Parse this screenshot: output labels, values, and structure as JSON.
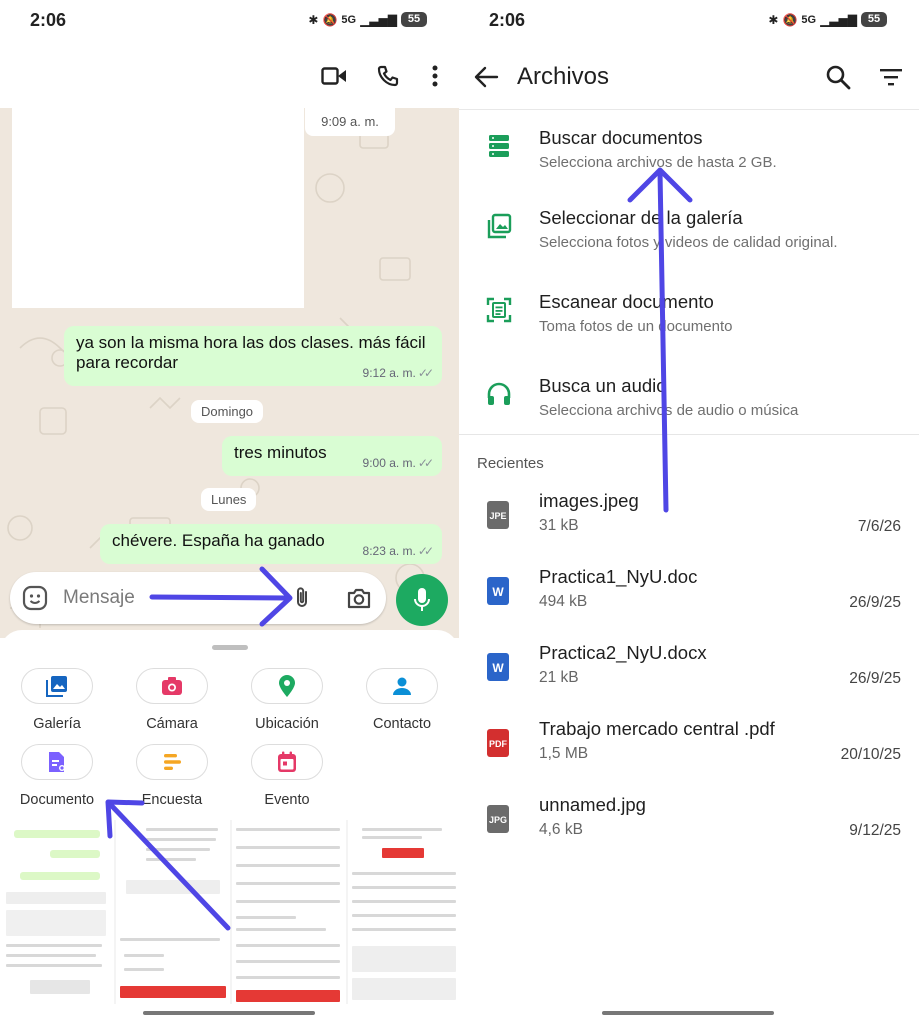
{
  "colors": {
    "whatsapp_green": "#1daa61",
    "bubble_out": "#d9fdd3",
    "chat_background": "#efe7dd",
    "annotation_arrow": "#4f46e5",
    "files_icon_green": "#1b9e5a"
  },
  "left_panel": {
    "status_bar": {
      "time": "2:06",
      "network": "5G",
      "battery": "55"
    },
    "header_icons": [
      "video-call-icon",
      "voice-call-icon",
      "more-options-icon"
    ],
    "image_time": "9:09 a. m.",
    "messages": [
      {
        "text": "ya son la misma hora las dos clases. más fácil para recordar",
        "time": "9:12 a. m.",
        "status": "read"
      },
      {
        "text": "tres minutos",
        "time": "9:00 a. m.",
        "status": "read"
      },
      {
        "text": "chévere. España ha ganado",
        "time": "8:23 a. m.",
        "status": "read"
      }
    ],
    "date_separators": [
      "Domingo",
      "Lunes"
    ],
    "input": {
      "placeholder": "Mensaje"
    },
    "attachments": [
      {
        "label": "Galería",
        "icon": "gallery-icon",
        "color": "#1565c0"
      },
      {
        "label": "Cámara",
        "icon": "camera-icon",
        "color": "#e53967"
      },
      {
        "label": "Ubicación",
        "icon": "location-icon",
        "color": "#1daa61"
      },
      {
        "label": "Contacto",
        "icon": "contact-icon",
        "color": "#0b8fd6"
      },
      {
        "label": "Documento",
        "icon": "document-icon",
        "color": "#7b61ff"
      },
      {
        "label": "Encuesta",
        "icon": "poll-icon",
        "color": "#f5a623"
      },
      {
        "label": "Evento",
        "icon": "event-icon",
        "color": "#e53967"
      }
    ],
    "gallery_thumbnails": 4
  },
  "right_panel": {
    "status_bar": {
      "time": "2:06",
      "network": "5G",
      "battery": "55"
    },
    "title": "Archivos",
    "options": [
      {
        "title": "Buscar documentos",
        "subtitle": "Selecciona archivos de hasta 2 GB.",
        "icon": "storage-icon"
      },
      {
        "title": "Seleccionar de la galería",
        "subtitle": "Selecciona fotos y videos de calidad original.",
        "icon": "gallery-icon"
      },
      {
        "title": "Escanear documento",
        "subtitle": "Toma fotos de un documento",
        "icon": "scan-document-icon"
      },
      {
        "title": "Busca un audio",
        "subtitle": "Selecciona archivos de audio o música",
        "icon": "headphones-icon"
      }
    ],
    "recent_header": "Recientes",
    "files": [
      {
        "name": "images.jpeg",
        "size": "31 kB",
        "date": "7/6/26",
        "badge": "JPE",
        "color": "#6b6b6b"
      },
      {
        "name": "Practica1_NyU.doc",
        "size": "494 kB",
        "date": "26/9/25",
        "badge": "W",
        "color": "#2b65c9"
      },
      {
        "name": "Practica2_NyU.docx",
        "size": "21 kB",
        "date": "26/9/25",
        "badge": "W",
        "color": "#2b65c9"
      },
      {
        "name": "Trabajo mercado central .pdf",
        "size": "1,5 MB",
        "date": "20/10/25",
        "badge": "PDF",
        "color": "#d32f2f"
      },
      {
        "name": "unnamed.jpg",
        "size": "4,6 kB",
        "date": "9/12/25",
        "badge": "JPG",
        "color": "#6b6b6b"
      }
    ]
  }
}
